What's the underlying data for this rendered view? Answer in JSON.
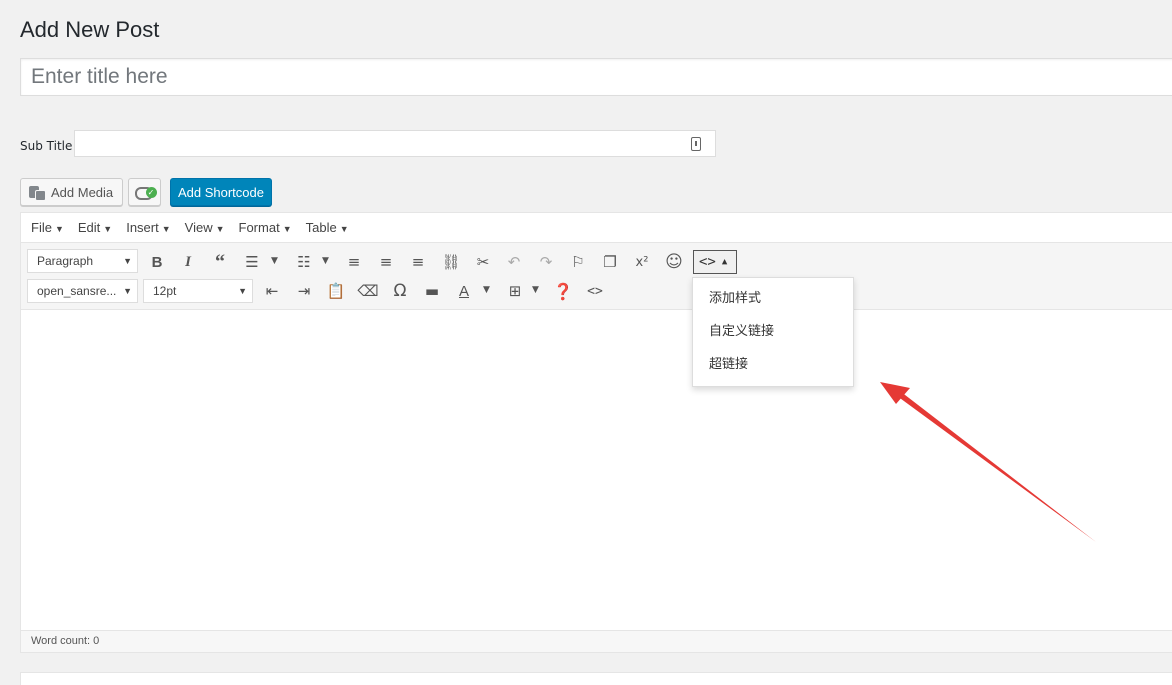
{
  "page": {
    "title": "Add New Post"
  },
  "title_field": {
    "placeholder": "Enter title here"
  },
  "subtitle": {
    "label": "Sub Title",
    "value": ""
  },
  "buttons": {
    "add_media": "Add Media",
    "add_shortcode": "Add Shortcode"
  },
  "menubar": [
    {
      "label": "File"
    },
    {
      "label": "Edit"
    },
    {
      "label": "Insert"
    },
    {
      "label": "View"
    },
    {
      "label": "Format"
    },
    {
      "label": "Table"
    }
  ],
  "toolbar": {
    "format_select": "Paragraph",
    "font_family_select": "open_sansre...",
    "font_size_select": "12pt"
  },
  "dropdown": {
    "items": [
      "添加样式",
      "自定义链接",
      "超链接"
    ]
  },
  "status": {
    "word_count": "Word count: 0"
  },
  "colors": {
    "primary": "#0085ba",
    "arrow": "#e53935"
  }
}
